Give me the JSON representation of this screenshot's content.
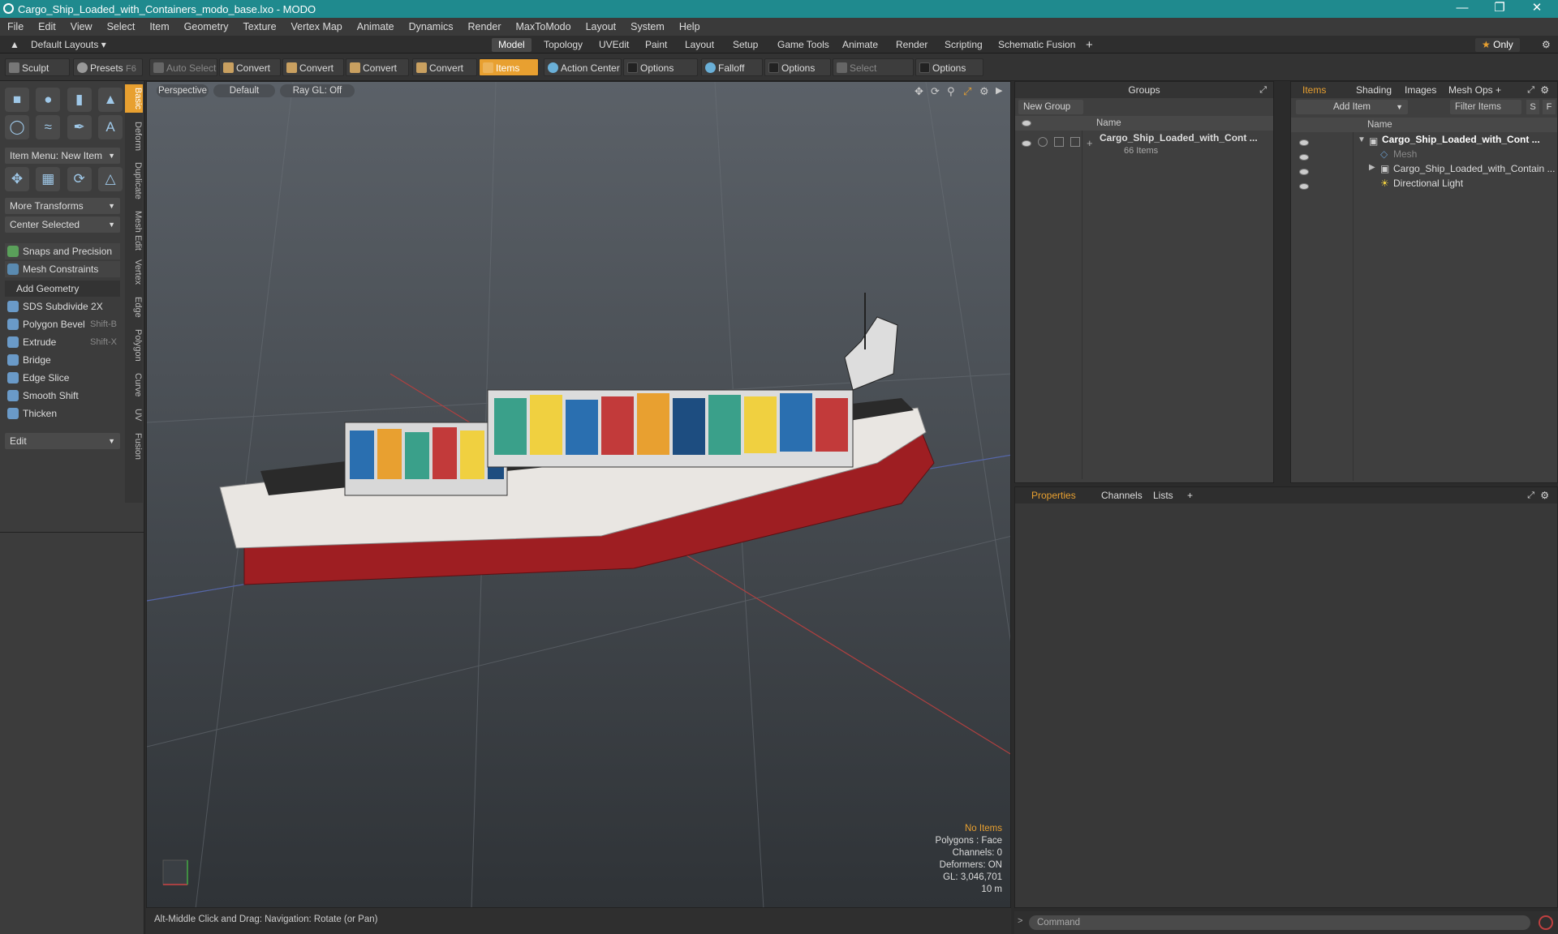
{
  "window": {
    "title": "Cargo_Ship_Loaded_with_Containers_modo_base.lxo - MODO"
  },
  "menu": [
    "File",
    "Edit",
    "View",
    "Select",
    "Item",
    "Geometry",
    "Texture",
    "Vertex Map",
    "Animate",
    "Dynamics",
    "Render",
    "MaxToModo",
    "Layout",
    "System",
    "Help"
  ],
  "layout_tabs": {
    "default_layouts": "Default Layouts",
    "tabs": [
      "Model",
      "Topology",
      "UVEdit",
      "Paint",
      "Layout",
      "Setup",
      "Game Tools",
      "Animate",
      "Render",
      "Scripting",
      "Schematic Fusion"
    ],
    "active": "Model",
    "only": "Only"
  },
  "toolbar": {
    "sculpt": "Sculpt",
    "presets": "Presets",
    "presets_key": "F6",
    "auto_select": "Auto Select",
    "convert": "Convert",
    "items": "Items",
    "action_center": "Action Center",
    "options": "Options",
    "falloff": "Falloff",
    "select_through": "Select Through"
  },
  "left_panel": {
    "vtabs": [
      "Basic",
      "Deform",
      "Duplicate",
      "Mesh Edit",
      "Vertex",
      "Edge",
      "Polygon",
      "Curve",
      "UV",
      "Fusion"
    ],
    "item_menu": "Item Menu: New Item",
    "more_transforms": "More Transforms",
    "center_selected": "Center Selected",
    "snaps": "Snaps and Precision",
    "mesh_constraints": "Mesh Constraints",
    "add_geometry": "Add Geometry",
    "tools": [
      {
        "label": "SDS Subdivide 2X",
        "shortcut": ""
      },
      {
        "label": "Polygon Bevel",
        "shortcut": "Shift-B"
      },
      {
        "label": "Extrude",
        "shortcut": "Shift-X"
      },
      {
        "label": "Bridge",
        "shortcut": ""
      },
      {
        "label": "Edge Slice",
        "shortcut": ""
      },
      {
        "label": "Smooth Shift",
        "shortcut": ""
      },
      {
        "label": "Thicken",
        "shortcut": ""
      }
    ],
    "edit": "Edit"
  },
  "viewport": {
    "perspective": "Perspective",
    "default": "Default",
    "raygl": "Ray GL: Off",
    "info": {
      "no_items": "No Items",
      "polygons": "Polygons : Face",
      "channels": "Channels: 0",
      "deformers": "Deformers: ON",
      "gl": "GL: 3,046,701",
      "scale": "10 m"
    },
    "status": "Alt-Middle Click and Drag:   Navigation: Rotate (or Pan)"
  },
  "groups_panel": {
    "title": "Groups",
    "new_group": "New Group",
    "col_name": "Name",
    "group_name": "Cargo_Ship_Loaded_with_Cont ...",
    "group_count": "66 Items"
  },
  "items_panel": {
    "tabs": [
      "Items",
      "Shading",
      "Images",
      "Mesh Ops"
    ],
    "add_item": "Add Item",
    "filter_items": "Filter Items",
    "s": "S",
    "f": "F",
    "col_name": "Name",
    "rows": [
      {
        "label": "Cargo_Ship_Loaded_with_Cont ...",
        "bold": true
      },
      {
        "label": "Mesh",
        "bold": false
      },
      {
        "label": "Cargo_Ship_Loaded_with_Contain ...",
        "bold": false
      },
      {
        "label": "Directional Light",
        "bold": false
      }
    ]
  },
  "properties_panel": {
    "tabs": [
      "Properties",
      "Channels",
      "Lists"
    ]
  },
  "command": {
    "placeholder": "Command"
  },
  "colors": {
    "accent": "#e8a030",
    "titlebar": "#1f8a8e",
    "hull": "#9e1e22"
  }
}
